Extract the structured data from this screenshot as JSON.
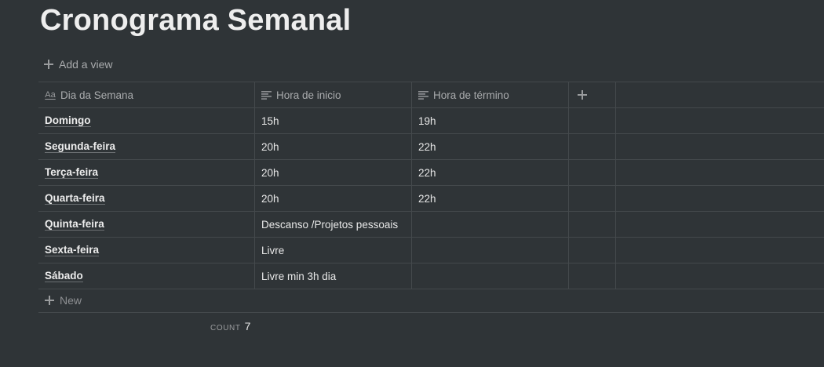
{
  "page": {
    "title": "Cronograma Semanal",
    "add_view_label": "Add a view"
  },
  "table": {
    "columns": [
      {
        "label": "Dia da Semana",
        "icon": "text-property-icon"
      },
      {
        "label": "Hora de inicio",
        "icon": "text-lines-icon"
      },
      {
        "label": "Hora de término",
        "icon": "text-lines-icon"
      }
    ],
    "add_column_icon": "plus-icon",
    "rows": [
      {
        "day": "Domingo",
        "start": "15h",
        "end": "19h"
      },
      {
        "day": "Segunda-feira",
        "start": "20h",
        "end": "22h"
      },
      {
        "day": "Terça-feira",
        "start": "20h",
        "end": "22h"
      },
      {
        "day": "Quarta-feira",
        "start": "20h",
        "end": "22h"
      },
      {
        "day": "Quinta-feira",
        "start": "Descanso /Projetos pessoais",
        "end": ""
      },
      {
        "day": "Sexta-feira",
        "start": "Livre",
        "end": ""
      },
      {
        "day": "Sábado",
        "start": "Livre min 3h dia",
        "end": ""
      }
    ],
    "new_label": "New",
    "count_label": "COUNT",
    "count_value": "7"
  }
}
